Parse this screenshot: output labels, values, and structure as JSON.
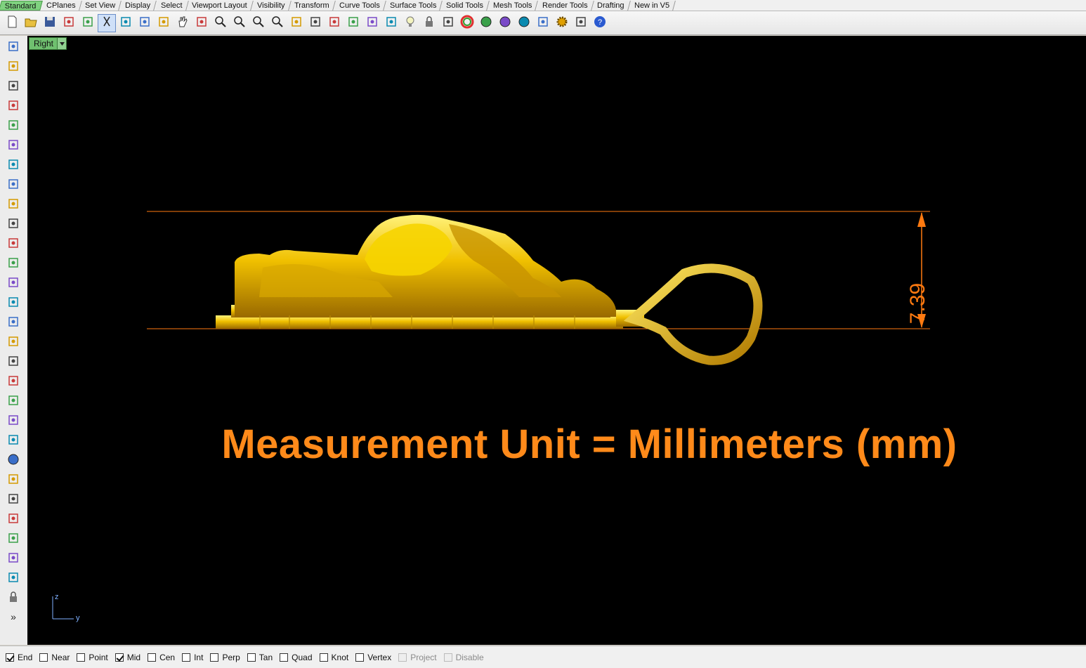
{
  "tabs": [
    {
      "label": "Standard",
      "active": true
    },
    {
      "label": "CPlanes"
    },
    {
      "label": "Set View"
    },
    {
      "label": "Display"
    },
    {
      "label": "Select"
    },
    {
      "label": "Viewport Layout"
    },
    {
      "label": "Visibility"
    },
    {
      "label": "Transform"
    },
    {
      "label": "Curve Tools"
    },
    {
      "label": "Surface Tools"
    },
    {
      "label": "Solid Tools"
    },
    {
      "label": "Mesh Tools"
    },
    {
      "label": "Render Tools"
    },
    {
      "label": "Drafting"
    },
    {
      "label": "New in V5"
    }
  ],
  "toolbar_icons": [
    "new-icon",
    "open-icon",
    "save-icon",
    "print-icon",
    "paste-clipboard-icon",
    "cut-icon",
    "copy-icon",
    "clipboard-icon",
    "undo-icon",
    "pan-hand-icon",
    "rotate-view-icon",
    "zoom-icon",
    "zoom-window-icon",
    "zoom-extents-icon",
    "zoom-selected-icon",
    "undo-view-icon",
    "four-viewports-icon",
    "car-icon",
    "cplane-icon",
    "ruler-icon",
    "distance-icon",
    "light-icon",
    "lock-icon",
    "layers-icon",
    "color-wheel-icon",
    "shaded-sphere-icon",
    "rendered-sphere-icon",
    "blue-sphere-icon",
    "render-icon",
    "settings-gear-icon",
    "snap-grid-icon",
    "help-icon"
  ],
  "left_icons": [
    "select-arrow-icon",
    "point-icon",
    "polyline-icon",
    "curve-icon",
    "circle-icon",
    "ellipse-icon",
    "arc-icon",
    "rectangle-icon",
    "polygon-icon",
    "fillet-curve-icon",
    "surface-points-icon",
    "loft-surface-icon",
    "box-solid-icon",
    "boolean-union-icon",
    "cylinder-icon",
    "mesh-icon",
    "gumball-icon",
    "explode-icon",
    "trim-icon",
    "split-icon",
    "group-icon",
    "color-spheres-icon",
    "curve-edit-icon",
    "blend-curve-icon",
    "text-icon",
    "transform-icon",
    "array-icon",
    "extrude-icon",
    "block-icon",
    "more-icon"
  ],
  "viewport": {
    "name": "Right",
    "overlay_text": "Measurement Unit = Millimeters (mm)",
    "dimension_value": "7.39",
    "axis_vertical": "z",
    "axis_horizontal": "y"
  },
  "snaps": [
    {
      "label": "End",
      "checked": true
    },
    {
      "label": "Near",
      "checked": false
    },
    {
      "label": "Point",
      "checked": false
    },
    {
      "label": "Mid",
      "checked": true
    },
    {
      "label": "Cen",
      "checked": false
    },
    {
      "label": "Int",
      "checked": false
    },
    {
      "label": "Perp",
      "checked": false
    },
    {
      "label": "Tan",
      "checked": false
    },
    {
      "label": "Quad",
      "checked": false
    },
    {
      "label": "Knot",
      "checked": false
    },
    {
      "label": "Vertex",
      "checked": false
    },
    {
      "label": "Project",
      "checked": false,
      "disabled": true
    },
    {
      "label": "Disable",
      "checked": false,
      "disabled": true
    }
  ],
  "colors": {
    "accent_tab": "#7fd27f",
    "dimension": "#ff7a10",
    "model_gold": "#e8b800",
    "viewport_bg": "#000000"
  }
}
